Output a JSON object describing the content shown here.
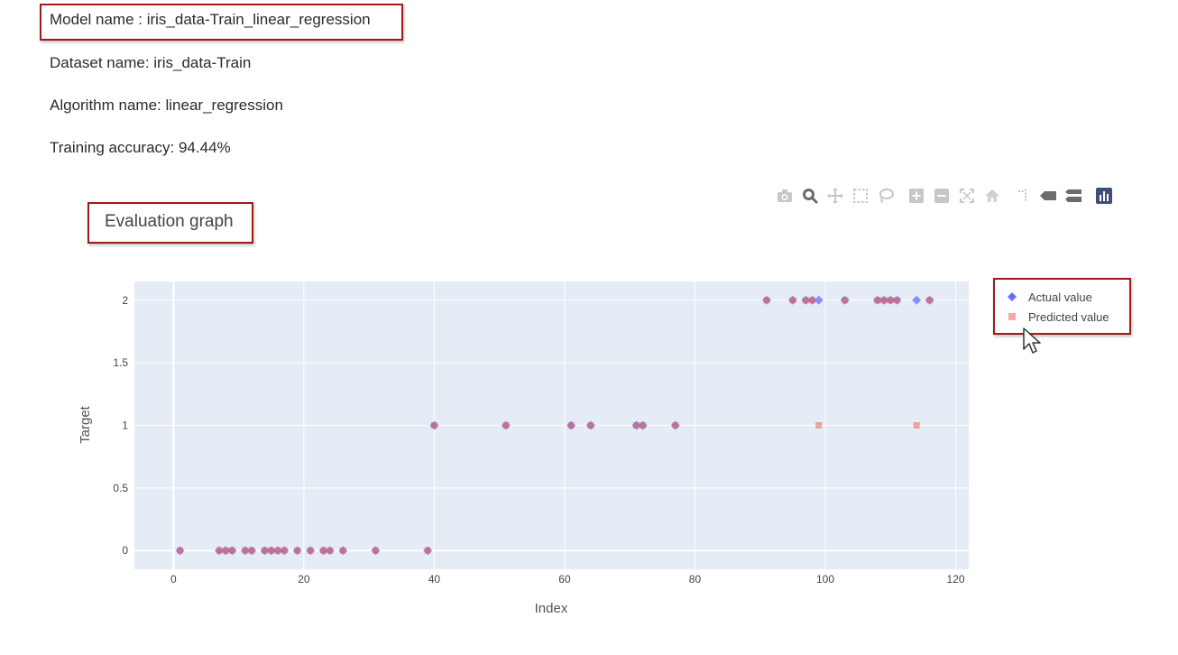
{
  "info": {
    "model_name": "Model name : iris_data-Train_linear_regression",
    "dataset_name": "Dataset name: iris_data-Train",
    "algorithm_name": "Algorithm name: linear_regression",
    "training_accuracy": "Training accuracy: 94.44%"
  },
  "graph_title": "Evaluation graph",
  "modebar": {
    "icons": [
      "camera-icon",
      "zoom-icon",
      "pan-icon",
      "box-select-icon",
      "lasso-select-icon",
      "zoom-in-icon",
      "zoom-out-icon",
      "autoscale-icon",
      "reset-axes-icon",
      "spike-lines-icon",
      "hover-closest-icon",
      "hover-compare-icon",
      "plotly-logo-icon"
    ]
  },
  "colors": {
    "actual": "#636efa",
    "predicted": "#ef553b",
    "plot_bg": "#e5ecf6",
    "highlight": "#a11a1a"
  },
  "chart_data": {
    "type": "scatter",
    "xlabel": "Index",
    "ylabel": "Target",
    "xlim": [
      -6,
      122
    ],
    "ylim": [
      -0.15,
      2.15
    ],
    "x_ticks": [
      0,
      20,
      40,
      60,
      80,
      100,
      120
    ],
    "y_ticks": [
      0,
      0.5,
      1,
      1.5,
      2
    ],
    "x_tick_labels": [
      "0",
      "20",
      "40",
      "60",
      "80",
      "100",
      "120"
    ],
    "y_tick_labels": [
      "0",
      "0.5",
      "1",
      "1.5",
      "2"
    ],
    "grid": true,
    "legend_position": "top-right outside",
    "series": [
      {
        "name": "Actual value",
        "marker": "diamond",
        "x": [
          1,
          7,
          8,
          9,
          11,
          12,
          14,
          15,
          16,
          17,
          19,
          21,
          23,
          24,
          26,
          31,
          39,
          40,
          51,
          61,
          64,
          71,
          72,
          77,
          91,
          95,
          97,
          98,
          99,
          103,
          108,
          109,
          110,
          111,
          114,
          116
        ],
        "y": [
          0,
          0,
          0,
          0,
          0,
          0,
          0,
          0,
          0,
          0,
          0,
          0,
          0,
          0,
          0,
          0,
          0,
          1,
          1,
          1,
          1,
          1,
          1,
          1,
          2,
          2,
          2,
          2,
          2,
          2,
          2,
          2,
          2,
          2,
          2,
          2
        ]
      },
      {
        "name": "Predicted value",
        "marker": "square",
        "x": [
          1,
          7,
          8,
          9,
          11,
          12,
          14,
          15,
          16,
          17,
          19,
          21,
          23,
          24,
          26,
          31,
          39,
          40,
          51,
          61,
          64,
          71,
          72,
          77,
          91,
          95,
          97,
          98,
          99,
          103,
          108,
          109,
          110,
          111,
          114,
          116
        ],
        "y": [
          0,
          0,
          0,
          0,
          0,
          0,
          0,
          0,
          0,
          0,
          0,
          0,
          0,
          0,
          0,
          0,
          0,
          1,
          1,
          1,
          1,
          1,
          1,
          1,
          2,
          2,
          2,
          2,
          1,
          2,
          2,
          2,
          2,
          2,
          1,
          2
        ]
      }
    ]
  }
}
